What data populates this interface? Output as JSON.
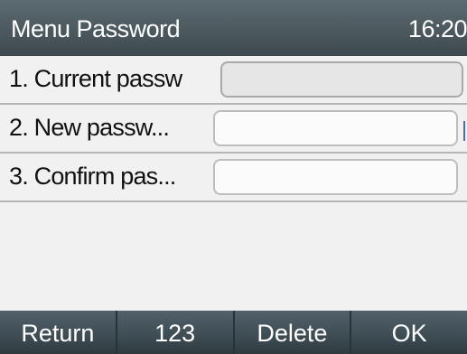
{
  "header": {
    "title": "Menu Password",
    "time": "16:20"
  },
  "fields": [
    {
      "label": "1.  Current passw",
      "value": ""
    },
    {
      "label": "2.  New passw...",
      "value": ""
    },
    {
      "label": "3.  Confirm pas...",
      "value": ""
    }
  ],
  "softkeys": {
    "return": "Return",
    "input_mode": "123",
    "delete": "Delete",
    "ok": "OK"
  }
}
